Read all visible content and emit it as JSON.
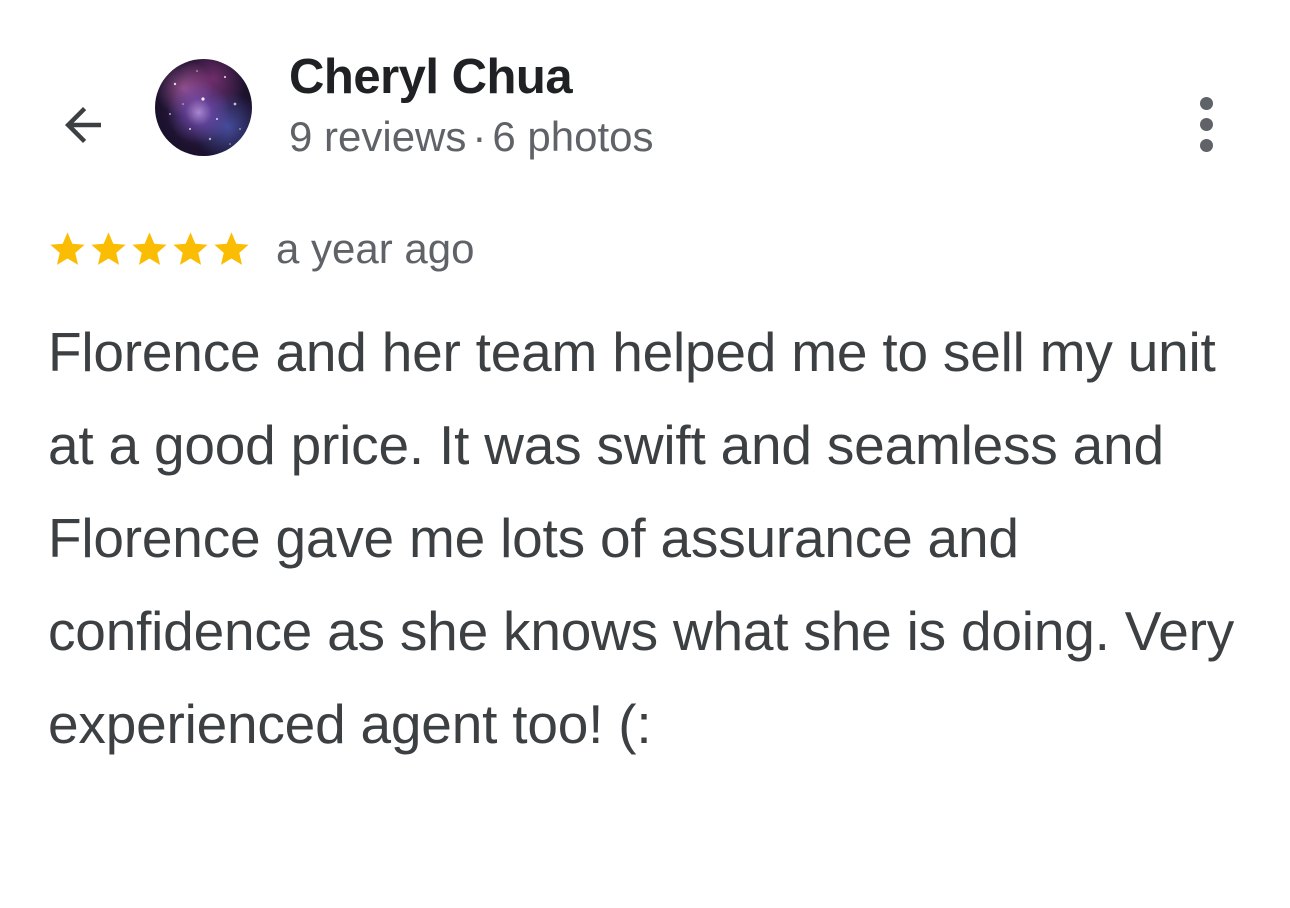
{
  "header": {
    "back_icon": "arrow-left-icon",
    "reviewer_name": "Cheryl Chua",
    "reviews_count": "9 reviews",
    "separator": "·",
    "photos_count": "6 photos",
    "more_icon": "more-vert-icon"
  },
  "review": {
    "rating": 5,
    "rating_max": 5,
    "star_color": "#fbbc04",
    "time_ago": "a year ago",
    "text": "Florence and her team helped me to sell my unit at a good price. It was swift and seamless and Florence gave me lots of assurance and confidence as she knows what she is doing. Very experienced agent too! (:"
  }
}
